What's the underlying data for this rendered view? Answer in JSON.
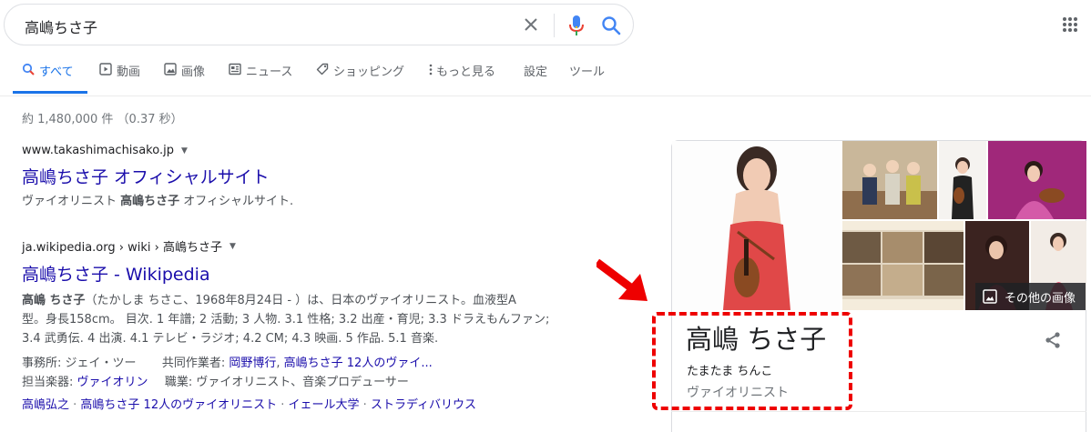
{
  "search": {
    "query": "高嶋ちさ子"
  },
  "icons": {
    "clear": "close-icon",
    "mic": "mic-icon",
    "search": "search-icon",
    "apps": "apps-grid-icon"
  },
  "colors": {
    "link": "#1a0dab",
    "accent": "#1a73e8",
    "annotation": "#e00000"
  },
  "tabs": [
    {
      "label": "すべて",
      "icon": "search-icon",
      "active": true
    },
    {
      "label": "動画",
      "icon": "video-icon"
    },
    {
      "label": "画像",
      "icon": "image-icon"
    },
    {
      "label": "ニュース",
      "icon": "news-icon"
    },
    {
      "label": "ショッピング",
      "icon": "tag-icon"
    },
    {
      "label": "もっと見る",
      "icon": "more-vert-icon"
    },
    {
      "label": "設定"
    },
    {
      "label": "ツール"
    }
  ],
  "result_stats": "約 1,480,000 件 （0.37 秒）",
  "results": [
    {
      "url": "www.takashimachisako.jp",
      "title": "高嶋ちさ子 オフィシャルサイト",
      "snippet_pre": "ヴァイオリニスト ",
      "snippet_bold": "高嶋ちさ子",
      "snippet_post": " オフィシャルサイト."
    },
    {
      "url": "ja.wikipedia.org › wiki › 高嶋ちさ子",
      "title": "高嶋ちさ子 - Wikipedia",
      "snippet_lines": [
        {
          "bold": "高嶋 ちさ子",
          "text": "（たかしま ちさこ、1968年8月24日 - ）は、日本のヴァイオリニスト。血液型A"
        },
        {
          "text": "型。身長158cm。 目次. 1 年譜; 2 活動; 3 人物. 3.1 性格; 3.2 出産・育児; 3.3 ドラえもんファン;"
        },
        {
          "text": "3.4 武勇伝. 4 出演. 4.1 テレビ・ラジオ; 4.2 CM; 4.3 映画. 5 作品. 5.1 音楽."
        }
      ],
      "facts": [
        {
          "k1": "事務所",
          "v1": "ジェイ・ツー",
          "k2": "共同作業者",
          "v2a": "岡野博行",
          "v2b": "高嶋ちさ子 12人のヴァイ..."
        },
        {
          "k1": "担当楽器",
          "v1": "ヴァイオリン",
          "k2": "職業",
          "v2": "ヴァイオリニスト、音楽プロデューサー"
        }
      ],
      "related_links": [
        "高嶋弘之",
        "高嶋ちさ子 12人のヴァイオリニスト",
        "イェール大学",
        "ストラディバリウス"
      ]
    }
  ],
  "knowledge_panel": {
    "name": "高嶋 ちさ子",
    "reading": "たまたま ちんこ",
    "role": "ヴァイオリニスト",
    "more_images": "その他の画像",
    "share_icon": "share-icon"
  }
}
